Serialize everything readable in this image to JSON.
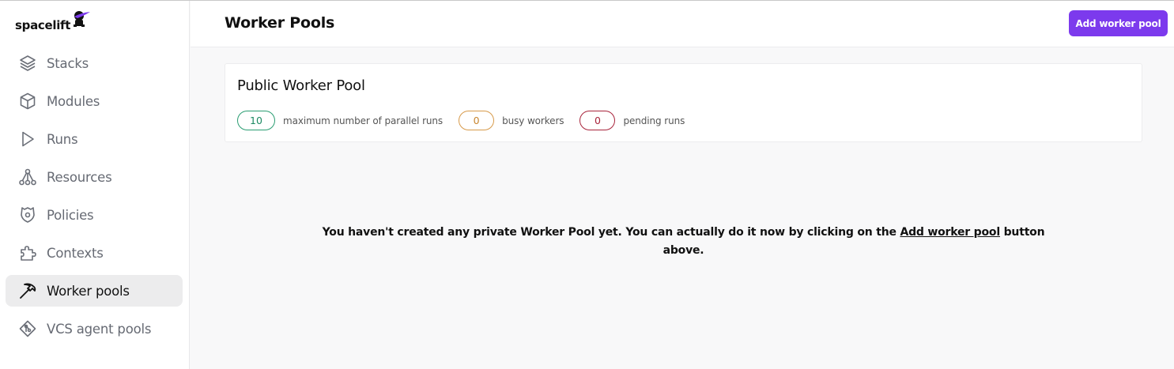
{
  "brand": {
    "name": "spacelift",
    "accent": "#7c3aed"
  },
  "sidebar": {
    "items": [
      {
        "label": "Stacks",
        "icon": "stack-icon",
        "active": false
      },
      {
        "label": "Modules",
        "icon": "cube-icon",
        "active": false
      },
      {
        "label": "Runs",
        "icon": "play-icon",
        "active": false
      },
      {
        "label": "Resources",
        "icon": "resources-icon",
        "active": false
      },
      {
        "label": "Policies",
        "icon": "shield-icon",
        "active": false
      },
      {
        "label": "Contexts",
        "icon": "puzzle-icon",
        "active": false
      },
      {
        "label": "Worker pools",
        "icon": "pickaxe-icon",
        "active": true
      },
      {
        "label": "VCS agent pools",
        "icon": "git-icon",
        "active": false
      }
    ]
  },
  "header": {
    "title": "Worker Pools",
    "add_button_label": "Add worker pool"
  },
  "public_pool": {
    "title": "Public Worker Pool",
    "stats": [
      {
        "value": "10",
        "label": "maximum number of parallel runs",
        "color": "#1d8a63"
      },
      {
        "value": "0",
        "label": "busy workers",
        "color": "#c8862f"
      },
      {
        "value": "0",
        "label": "pending runs",
        "color": "#a8243b"
      }
    ]
  },
  "empty_state": {
    "text_before": "You haven't created any private Worker Pool yet. You can actually do it now by clicking on the ",
    "link": "Add worker pool",
    "text_after": " button above."
  }
}
